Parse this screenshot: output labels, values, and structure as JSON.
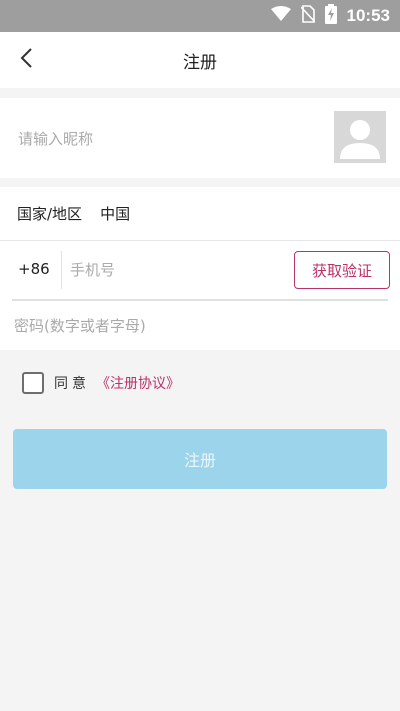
{
  "status_bar": {
    "time": "10:53",
    "icons": [
      "wifi-icon",
      "no-sim-icon",
      "battery-charging-icon"
    ]
  },
  "header": {
    "title": "注册",
    "back_icon": "chevron-left-icon"
  },
  "nickname": {
    "placeholder": "请输入昵称",
    "avatar_icon": "default-avatar-icon"
  },
  "region": {
    "label": "国家/地区",
    "value": "中国"
  },
  "phone": {
    "country_code": "+86",
    "placeholder": "手机号",
    "value": "",
    "get_code_label": "获取验证"
  },
  "password": {
    "placeholder": "密码(数字或者字母)",
    "value": ""
  },
  "agreement": {
    "checked": false,
    "agree_label": "同意",
    "link_label": "《注册协议》"
  },
  "submit": {
    "label": "注册"
  },
  "colors": {
    "accent": "#b8336a",
    "button_disabled": "#9cd4ec",
    "background": "#f4f4f4",
    "status_bar": "#9e9e9e"
  }
}
